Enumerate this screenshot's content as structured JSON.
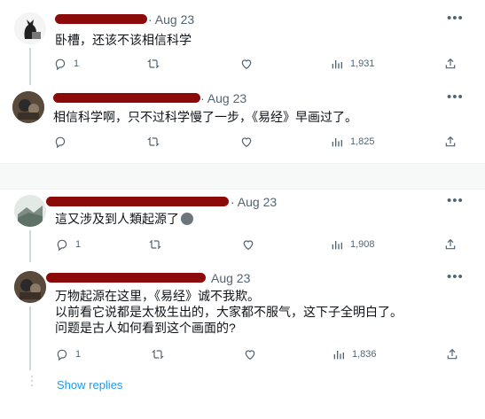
{
  "tweets": [
    {
      "date": "· Aug 23",
      "text": [
        "卧槽，还该不该相信科学"
      ],
      "replies": "1",
      "views": "1,931"
    },
    {
      "date": "· Aug 23",
      "text": [
        "相信科学啊，只不过科学慢了一步，《易经》早画过了。"
      ],
      "replies": "",
      "views": "1,825"
    },
    {
      "date": "· Aug 23",
      "text": [
        "這又涉及到人類起源了"
      ],
      "replies": "1",
      "views": "1,908"
    },
    {
      "date": "Aug 23",
      "text": [
        "万物起源在这里，《易经》诚不我欺。",
        "以前看它说都是太极生出的，大家都不服气，这下子全明白了。",
        "问题是古人如何看到这个画面的?"
      ],
      "replies": "1",
      "views": "1,836"
    }
  ],
  "show_replies": "Show replies",
  "colors": {
    "accent": "#1d9bf0",
    "muted": "#536471",
    "redaction": "#8b0a0a"
  },
  "icons": [
    "reply-icon",
    "retweet-icon",
    "like-icon",
    "views-icon",
    "share-icon",
    "more-icon"
  ]
}
